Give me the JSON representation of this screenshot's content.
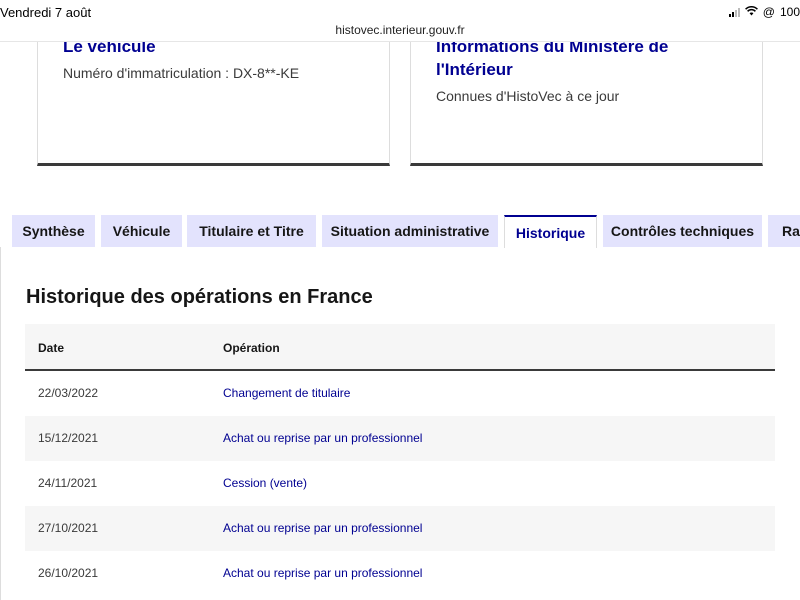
{
  "status_bar": {
    "time": "Vendredi 7 août",
    "url": "histovec.interieur.gouv.fr",
    "battery": "100"
  },
  "cards": [
    {
      "title": "Le véhicule",
      "text": "Numéro d'immatriculation : DX-8**-KE"
    },
    {
      "title_line1": "Informations du Ministère de",
      "title_line2": "l'Intérieur",
      "text": "Connues d'HistoVec à ce jour"
    }
  ],
  "tabs": [
    {
      "label": "Synthèse"
    },
    {
      "label": "Véhicule"
    },
    {
      "label": "Titulaire et Titre"
    },
    {
      "label": "Situation administrative"
    },
    {
      "label": "Historique"
    },
    {
      "label": "Contrôles techniques"
    },
    {
      "label": "Rap"
    }
  ],
  "active_tab": "Historique",
  "section": {
    "title": "Historique des opérations en France",
    "columns": [
      "Date",
      "Opération"
    ],
    "rows": [
      {
        "date": "22/03/2022",
        "operation": "Changement de titulaire"
      },
      {
        "date": "15/12/2021",
        "operation": "Achat ou reprise par un professionnel"
      },
      {
        "date": "24/11/2021",
        "operation": "Cession (vente)"
      },
      {
        "date": "27/10/2021",
        "operation": "Achat ou reprise par un professionnel"
      },
      {
        "date": "26/10/2021",
        "operation": "Achat ou reprise par un professionnel"
      }
    ]
  },
  "colors": {
    "primary_blue": "#000091",
    "tab_bg": "#e3e3fd",
    "row_alt": "#f6f6f6"
  }
}
